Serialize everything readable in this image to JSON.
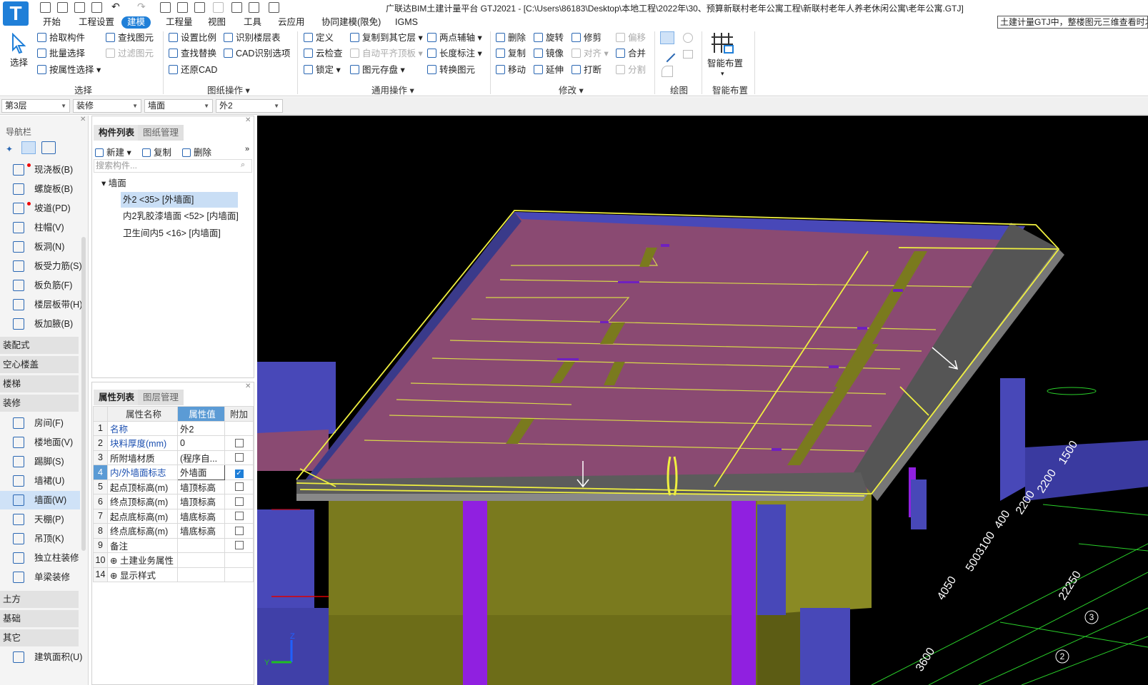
{
  "app": {
    "title": "广联达BIM土建计量平台 GTJ2021 - [C:\\Users\\86183\\Desktop\\本地工程\\2022年\\30、预算新联村老年公寓工程\\新联村老年人养老休闲公寓\\老年公寓.GTJ]",
    "logo": "T",
    "hint_box": "土建计量GTJ中，整楼图元三维查看时才"
  },
  "menu": [
    "开始",
    "工程设置",
    "建模",
    "工程量",
    "视图",
    "工具",
    "云应用",
    "协同建模(限免)",
    "IGMS"
  ],
  "menu_active": "建模",
  "ribbon": {
    "select": {
      "big": "选择",
      "items": [
        "拾取构件",
        "批量选择",
        "按属性选择"
      ],
      "items2": [
        "查找图元",
        "过滤图元"
      ],
      "group": "选择"
    },
    "drawing": {
      "items": [
        "设置比例",
        "查找替换",
        "还原CAD"
      ],
      "items2": [
        "识别楼层表",
        "CAD识别选项"
      ],
      "group": "图纸操作"
    },
    "common": {
      "items": [
        "定义",
        "云检查",
        "锁定"
      ],
      "items2": [
        "复制到其它层",
        "自动平齐顶板",
        "图元存盘"
      ],
      "items3": [
        "两点辅轴",
        "长度标注",
        "转换图元"
      ],
      "group": "通用操作"
    },
    "modify": {
      "items": [
        "删除",
        "复制",
        "移动"
      ],
      "items2": [
        "旋转",
        "镜像",
        "延伸"
      ],
      "items3": [
        "修剪",
        "对齐",
        "打断"
      ],
      "items4": [
        "偏移",
        "合并",
        "分割"
      ],
      "group": "修改"
    },
    "draw": {
      "group": "绘图"
    },
    "smart": {
      "big": "智能布置",
      "group": "智能布置"
    }
  },
  "combos": [
    "第3层",
    "装修",
    "墙面",
    "外2"
  ],
  "nav": {
    "title": "导航栏",
    "items_top": [
      "现浇板(B)",
      "螺旋板(B)",
      "坡道(PD)",
      "柱帽(V)",
      "板洞(N)",
      "板受力筋(S)",
      "板负筋(F)",
      "楼层板带(H)",
      "板加腋(B)"
    ],
    "groups_mid": [
      "装配式",
      "空心楼盖",
      "楼梯",
      "装修"
    ],
    "items_deco": [
      "房间(F)",
      "楼地面(V)",
      "踢脚(S)",
      "墙裙(U)",
      "墙面(W)",
      "天棚(P)",
      "吊顶(K)",
      "独立柱装修",
      "单梁装修"
    ],
    "groups_bottom": [
      "土方",
      "基础",
      "其它"
    ],
    "items_other": [
      "建筑面积(U)"
    ]
  },
  "component_panel": {
    "tabs": [
      "构件列表",
      "图纸管理"
    ],
    "toolbar": [
      "新建",
      "复制",
      "删除"
    ],
    "search_placeholder": "搜索构件...",
    "tree_root": "墙面",
    "tree_items": [
      "外2 <35> [外墙面]",
      "内2乳胶漆墙面 <52> [内墙面]",
      "卫生间内5 <16> [内墙面]"
    ]
  },
  "property_panel": {
    "tabs": [
      "属性列表",
      "图层管理"
    ],
    "headers": [
      "属性名称",
      "属性值",
      "附加"
    ],
    "rows": [
      {
        "no": "1",
        "name": "名称",
        "value": "外2",
        "blue": true,
        "check": null
      },
      {
        "no": "2",
        "name": "块料厚度(mm)",
        "value": "0",
        "blue": true,
        "check": false
      },
      {
        "no": "3",
        "name": "所附墙材质",
        "value": "(程序自...",
        "blue": false,
        "check": false
      },
      {
        "no": "4",
        "name": "内/外墙面标志",
        "value": "外墙面",
        "blue": true,
        "check": true
      },
      {
        "no": "5",
        "name": "起点顶标高(m)",
        "value": "墙顶标高",
        "blue": false,
        "check": false
      },
      {
        "no": "6",
        "name": "终点顶标高(m)",
        "value": "墙顶标高",
        "blue": false,
        "check": false
      },
      {
        "no": "7",
        "name": "起点底标高(m)",
        "value": "墙底标高",
        "blue": false,
        "check": false
      },
      {
        "no": "8",
        "name": "终点底标高(m)",
        "value": "墙底标高",
        "blue": false,
        "check": false
      },
      {
        "no": "9",
        "name": "备注",
        "value": "",
        "blue": false,
        "check": false
      },
      {
        "no": "10",
        "name": "⊕ 土建业务属性",
        "value": "",
        "blue": false,
        "check": null
      },
      {
        "no": "14",
        "name": "⊕ 显示样式",
        "value": "",
        "blue": false,
        "check": null
      }
    ]
  },
  "viewport": {
    "dims": [
      "4050",
      "5003100",
      "400",
      "2200",
      "2200",
      "1500",
      "22250",
      "3600"
    ],
    "axis_labels": [
      "3",
      "2"
    ]
  },
  "colors": {
    "accent": "#1f7fd8",
    "roof": "#8a4a72",
    "wall": "#7a7a1e",
    "blue_wall": "#4848b8",
    "purple": "#9020e0"
  }
}
